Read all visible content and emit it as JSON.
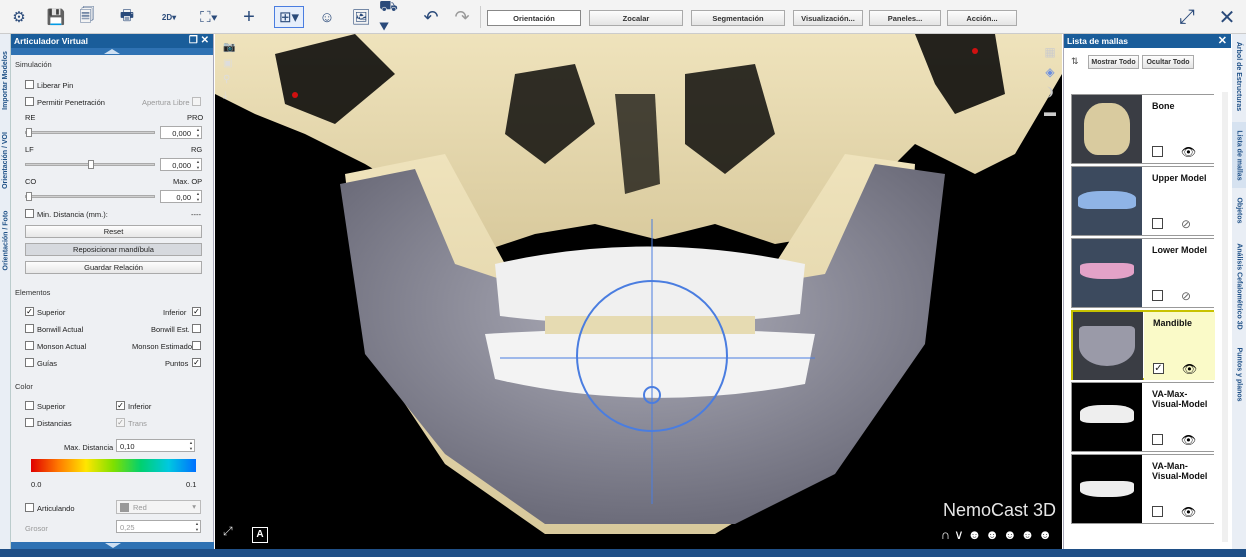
{
  "toolbar": {
    "buttons": [
      "Orientación",
      "Zocalar",
      "Segmentación",
      "Visualización...",
      "Paneles...",
      "Acción..."
    ],
    "view_2d_label": "2D"
  },
  "left_tabs": [
    "Importar Modelos",
    "Orientación / VOI",
    "Orientación / Foto"
  ],
  "articulator": {
    "title": "Articulador Virtual",
    "simulation_header": "Simulación",
    "liberar_pin": "Liberar Pin",
    "permitir_penetracion": "Permitir Penetración",
    "apertura_libre": "Apertura Libre",
    "re_label": "RE",
    "pro_label": "PRO",
    "slider1_value": "0,000",
    "lf_label": "LF",
    "rg_label": "RG",
    "slider2_value": "0,000",
    "co_label": "CO",
    "maxop_label": "Max. OP",
    "slider3_value": "0,00",
    "min_distancia": "Min. Distancia (mm.):",
    "min_distancia_value": "----",
    "reset": "Reset",
    "reposicionar": "Reposicionar mandíbula",
    "guardar": "Guardar Relación",
    "elementos_header": "Elementos",
    "superior": "Superior",
    "inferior": "Inferior",
    "bonwill_actual": "Bonwill Actual",
    "bonwill_est": "Bonwill Est.",
    "monson_actual": "Monson Actual",
    "monson_estimado": "Monson Estimado",
    "guias": "Guías",
    "puntos": "Puntos",
    "color_header": "Color",
    "color_superior": "Superior",
    "color_inferior": "Inferior",
    "distancias": "Distancias",
    "trans": "Trans",
    "max_distancia_label": "Max. Distancia",
    "max_distancia_value": "0,10",
    "grad_min": "0.0",
    "grad_max": "0.1",
    "articulando": "Articulando",
    "red_label": "Red",
    "grosor": "Grosor",
    "grosor_value": "0,25"
  },
  "viewport": {
    "watermark": "NemoCast 3D",
    "a_label": "A"
  },
  "mesh_list": {
    "title": "Lista de mallas",
    "show_all": "Mostrar Todo",
    "hide_all": "Ocultar Todo",
    "items": [
      {
        "name": "Bone",
        "checked": false,
        "visible": true,
        "selected": false
      },
      {
        "name": "Upper Model",
        "checked": false,
        "visible": false,
        "selected": false
      },
      {
        "name": "Lower Model",
        "checked": false,
        "visible": false,
        "selected": false
      },
      {
        "name": "Mandible",
        "checked": true,
        "visible": true,
        "selected": true
      },
      {
        "name": "VA-Max-Visual-Model",
        "checked": false,
        "visible": true,
        "selected": false
      },
      {
        "name": "VA-Man-Visual-Model",
        "checked": false,
        "visible": true,
        "selected": false
      }
    ]
  },
  "right_tabs": [
    "Árbol de Estructuras",
    "Lista de mallas",
    "Objetos",
    "Análisis Cefalométrico 3D",
    "Puntos y planos"
  ],
  "colors": {
    "accent": "#1a5d9a",
    "bone": "#e8dbb0",
    "crosshair": "#4a7de0",
    "selected": "#fafac8"
  }
}
